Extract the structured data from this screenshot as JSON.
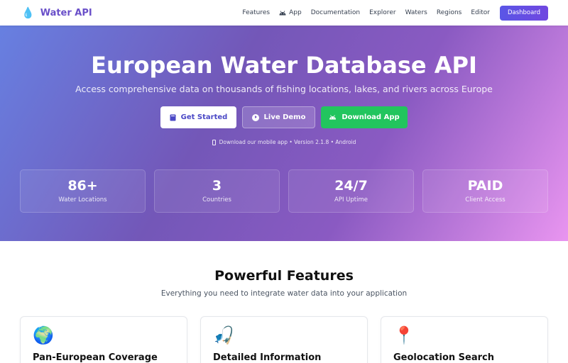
{
  "nav": {
    "brand_icon": "water-drop-icon",
    "brand": "Water API",
    "links": [
      "Features",
      "App",
      "Documentation",
      "Explorer",
      "Waters",
      "Regions",
      "Editor"
    ],
    "dashboard": "Dashboard"
  },
  "hero": {
    "title": "European Water Database API",
    "subtitle": "Access comprehensive data on thousands of fishing locations, lakes, and rivers across Europe",
    "buttons": {
      "get_started": "Get Started",
      "live_demo": "Live Demo",
      "download_app": "Download App"
    },
    "mobile_note": "Download our mobile app • Version 2.1.8 • Android",
    "stats": [
      {
        "value": "86+",
        "label": "Water Locations"
      },
      {
        "value": "3",
        "label": "Countries"
      },
      {
        "value": "24/7",
        "label": "API Uptime"
      },
      {
        "value": "PAID",
        "label": "Client Access"
      }
    ]
  },
  "features": {
    "title": "Powerful Features",
    "subtitle": "Everything you need to integrate water data into your application",
    "cards": [
      {
        "icon": "globe-icon",
        "title": "Pan-European Coverage"
      },
      {
        "icon": "fishing-pole-icon",
        "title": "Detailed Information"
      },
      {
        "icon": "pin-icon",
        "title": "Geolocation Search"
      }
    ]
  },
  "colors": {
    "brand": "#6a50c9",
    "dashboard_button": "#5a56e6",
    "download_button": "#22c55e",
    "hero_gradient_start": "#6780e1",
    "hero_gradient_end": "#e995f0"
  }
}
